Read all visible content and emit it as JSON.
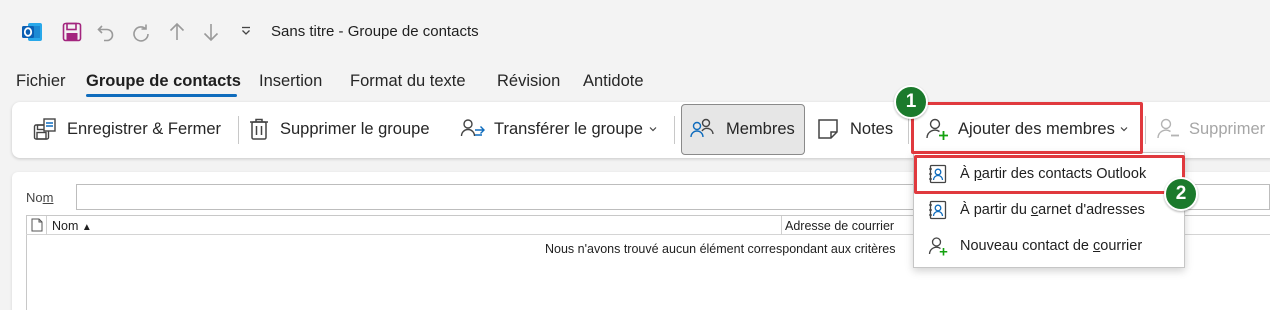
{
  "window": {
    "title": "Sans titre  -  Groupe de contacts"
  },
  "quick_access": [
    "outlook-logo-icon",
    "save-icon",
    "undo-icon",
    "redo-icon",
    "up-arrow-icon",
    "down-arrow-icon",
    "customize-qat-icon"
  ],
  "tabs": [
    {
      "label": "Fichier"
    },
    {
      "label": "Groupe de contacts",
      "active": true
    },
    {
      "label": "Insertion"
    },
    {
      "label": "Format du texte"
    },
    {
      "label": "Révision"
    },
    {
      "label": "Antidote"
    }
  ],
  "ribbon": {
    "save_close": "Enregistrer & Fermer",
    "delete_group": "Supprimer le groupe",
    "forward_group": "Transférer le groupe",
    "members": "Membres",
    "notes": "Notes",
    "add_members": "Ajouter des membres",
    "remove": "Supprimer"
  },
  "form": {
    "name_label_pre": "No",
    "name_label_acc": "m",
    "name_value": "",
    "columns": {
      "name": "Nom",
      "email": "Adresse de courrier"
    },
    "empty_message": "Nous n'avons trouvé aucun élément correspondant aux critères"
  },
  "menu": {
    "outlook_pre": "À ",
    "outlook_acc": "p",
    "outlook_post": "artir des contacts Outlook",
    "address_pre": "À partir du ",
    "address_acc": "c",
    "address_post": "arnet d'adresses",
    "new_pre": "Nouveau contact de ",
    "new_acc": "c",
    "new_post": "ourrier"
  },
  "callouts": {
    "one": "1",
    "two": "2"
  },
  "colors": {
    "accent": "#0f6cbd",
    "highlight": "#e0393e",
    "badge": "#1b7a2c",
    "members_fill": "#e6e6e6"
  }
}
